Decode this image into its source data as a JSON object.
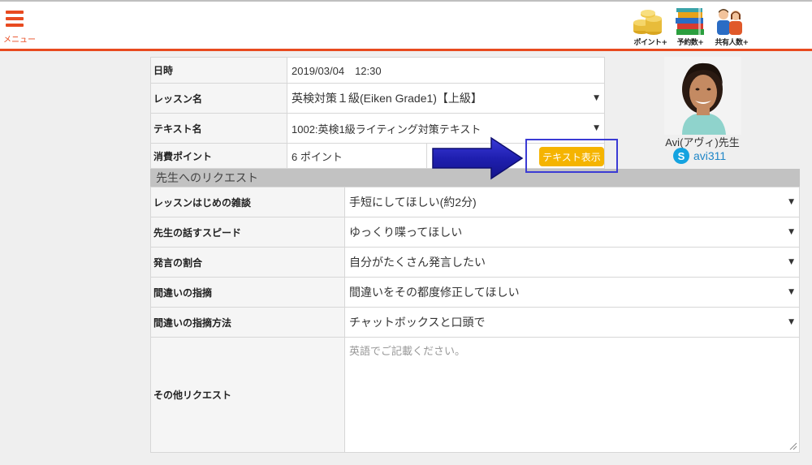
{
  "header": {
    "menu_label": "メニュー",
    "icons": [
      {
        "label": "ポイント+",
        "icon": "coins-icon"
      },
      {
        "label": "予約数+",
        "icon": "books-icon"
      },
      {
        "label": "共有人数+",
        "icon": "people-icon"
      }
    ],
    "accent_color": "#e84a1f"
  },
  "lesson": {
    "date_label": "日時",
    "date_value": "2019/03/04　12:30",
    "lesson_label": "レッスン名",
    "lesson_value": "英検対策１級(Eiken Grade1)【上級】",
    "text_label": "テキスト名",
    "text_value": "1002:英検1級ライティング対策テキスト",
    "points_label": "消費ポイント",
    "points_value": "6 ポイント",
    "show_text_button": "テキスト表示"
  },
  "request": {
    "section_title": "先生へのリクエスト",
    "rows": [
      {
        "label": "レッスンはじめの雑談",
        "value": "手短にしてほしい(約2分)"
      },
      {
        "label": "先生の話すスピード",
        "value": "ゆっくり喋ってほしい"
      },
      {
        "label": "発言の割合",
        "value": "自分がたくさん発言したい"
      },
      {
        "label": "間違いの指摘",
        "value": "間違いをその都度修正してほしい"
      },
      {
        "label": "間違いの指摘方法",
        "value": "チャットボックスと口頭で"
      }
    ],
    "other_label": "その他リクエスト",
    "other_placeholder": "英語でご記載ください。"
  },
  "teacher": {
    "name": "Avi(アヴィ)先生",
    "skype_id": "avi311"
  }
}
